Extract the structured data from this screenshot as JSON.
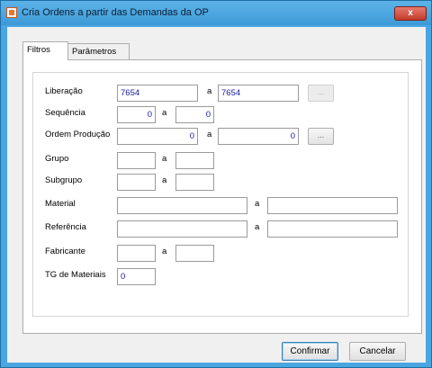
{
  "window": {
    "title": "Cria Ordens a partir das Demandas da OP",
    "close_label": "x"
  },
  "tabs": [
    {
      "label": "Filtros",
      "active": true
    },
    {
      "label": "Parâmetros",
      "active": false
    }
  ],
  "separator": "a",
  "browse_label": "...",
  "fields": {
    "liberacao": {
      "label": "Liberação",
      "from": "7654",
      "to": "7654"
    },
    "sequencia": {
      "label": "Sequência",
      "from": "0",
      "to": "0"
    },
    "ordem_producao": {
      "label": "Ordem Produção",
      "from": "0",
      "to": "0"
    },
    "grupo": {
      "label": "Grupo",
      "from": "",
      "to": ""
    },
    "subgrupo": {
      "label": "Subgrupo",
      "from": "",
      "to": ""
    },
    "material": {
      "label": "Material",
      "from": "",
      "to": ""
    },
    "referencia": {
      "label": "Referência",
      "from": "",
      "to": ""
    },
    "fabricante": {
      "label": "Fabricante",
      "from": "",
      "to": ""
    },
    "tg_materiais": {
      "label": "TG de Materiais",
      "value": "0"
    }
  },
  "buttons": {
    "confirm": "Confirmar",
    "cancel": "Cancelar"
  }
}
